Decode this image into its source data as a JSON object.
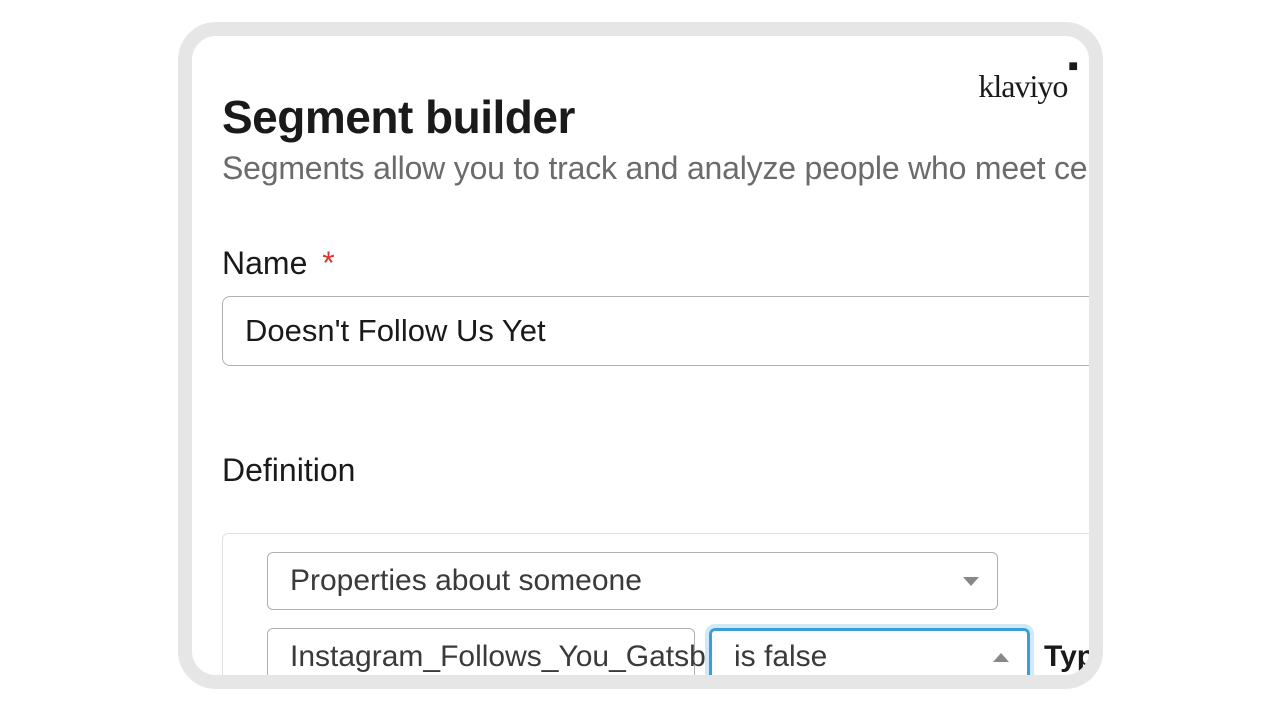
{
  "logo": {
    "text": "klaviyo",
    "mark": "■"
  },
  "header": {
    "title": "Segment builder",
    "subtitle": "Segments allow you to track and analyze people who meet certai"
  },
  "name_field": {
    "label": "Name",
    "required_mark": "*",
    "value": "Doesn't Follow Us Yet"
  },
  "definition": {
    "label": "Definition",
    "condition_type": "Properties about someone",
    "property": "Instagram_Follows_You_Gatsby",
    "operator": "is false",
    "type_label_partial": "Typ"
  }
}
